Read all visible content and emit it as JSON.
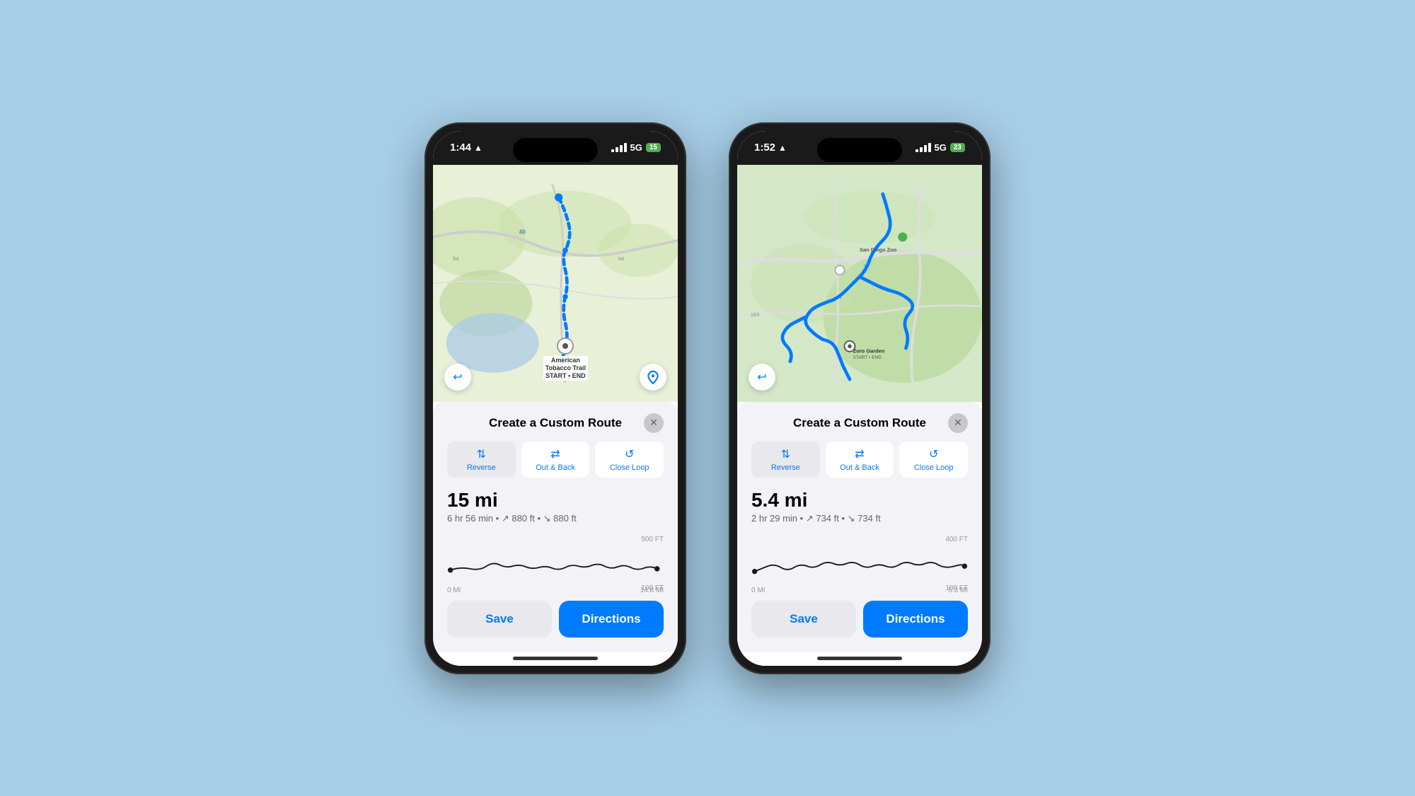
{
  "background": "#a8cfe8",
  "phone1": {
    "time": "1:44",
    "signal": "5G",
    "battery": "15",
    "map": {
      "type": "trail",
      "location": "American Tobacco Trail",
      "sublocation": "START • END"
    },
    "sheet": {
      "title": "Create a Custom Route",
      "segments": [
        {
          "label": "Reverse",
          "icon": "⇅",
          "active": true
        },
        {
          "label": "Out & Back",
          "icon": "⇄",
          "active": false
        },
        {
          "label": "Close Loop",
          "icon": "↺",
          "active": false
        }
      ],
      "distance": "15 mi",
      "time": "6 hr 56 min",
      "elevation_up": "880 ft",
      "elevation_down": "880 ft",
      "chart": {
        "y_labels": [
          "500 FT",
          "100 FT"
        ],
        "x_labels": [
          "0 MI",
          "14.8 MI"
        ]
      },
      "save_label": "Save",
      "directions_label": "Directions"
    }
  },
  "phone2": {
    "time": "1:52",
    "signal": "5G",
    "battery": "23",
    "map": {
      "type": "urban",
      "location": "Zoro Garden",
      "sublocation": "START • END"
    },
    "sheet": {
      "title": "Create a Custom Route",
      "segments": [
        {
          "label": "Reverse",
          "icon": "⇅",
          "active": true
        },
        {
          "label": "Out & Back",
          "icon": "⇄",
          "active": false
        },
        {
          "label": "Close Loop",
          "icon": "↺",
          "active": false
        }
      ],
      "distance": "5.4 mi",
      "time": "2 hr 29 min",
      "elevation_up": "734 ft",
      "elevation_down": "734 ft",
      "chart": {
        "y_labels": [
          "400 FT",
          "100 FT"
        ],
        "x_labels": [
          "0 MI",
          "5.3 MI"
        ]
      },
      "save_label": "Save",
      "directions_label": "Directions"
    }
  }
}
